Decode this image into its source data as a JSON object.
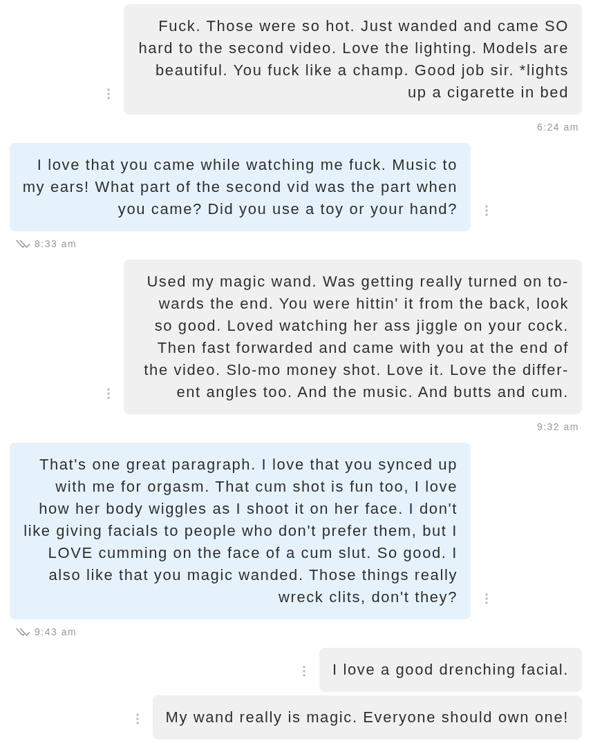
{
  "messages": [
    {
      "kind": "received",
      "text": "Fuck. Those were so hot. Just wanded and came SO hard to the second video. Love the lighting. Models are beautiful. You fuck like a champ. Good job sir. *lights up a cigarette in bed",
      "time": "6:24 am"
    },
    {
      "kind": "sent",
      "text": "I love that you came while watching me fuck. Music to my ears! What part of the second vid was the part when you came? Did you use a toy or your hand?",
      "time": "8:33 am"
    },
    {
      "kind": "received",
      "text": "Used my magic wand. Was getting really turned on to-wards the end. You were hittin' it from the back, look so good. Loved watching her ass jiggle on your cock. Then fast forwarded and came with you at the end of the video. Slo-mo money shot. Love it. Love the differ-ent angles too. And the music. And butts and cum.",
      "time": "9:32 am"
    },
    {
      "kind": "sent",
      "text": "That's one great paragraph. I love that you synced up with me for orgasm. That cum shot is fun too, I love how her body wiggles as I shoot it on her face. I don't like giving facials to people who don't prefer them, but I LOVE cumming on the face of a cum slut. So good. I also like that you magic wanded. Those things really wreck clits, don't they?",
      "time": "9:43 am"
    },
    {
      "kind": "received",
      "text": "I love a good drenching facial."
    },
    {
      "kind": "received",
      "text": "My wand really is magic. Everyone should own one!"
    }
  ]
}
